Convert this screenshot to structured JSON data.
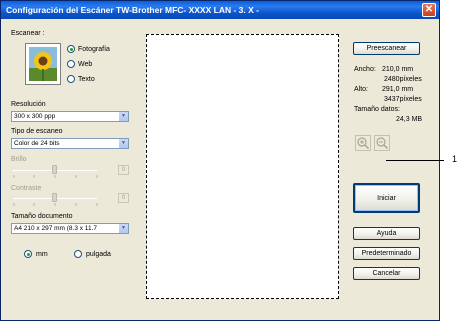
{
  "window": {
    "title": "Configuración del Escáner TW-Brother MFC- XXXX   LAN - 3. X -",
    "close_label": "✕"
  },
  "scan": {
    "label": "Escanear :",
    "options": [
      "Fotografía",
      "Web",
      "Texto"
    ],
    "selected": "Fotografía"
  },
  "resolution": {
    "label": "Resolución",
    "value": "300 x 300 ppp"
  },
  "scan_type": {
    "label": "Tipo de escaneo",
    "value": "Color de 24 bits"
  },
  "brightness": {
    "label": "Brillo",
    "value": "0"
  },
  "contrast": {
    "label": "Contraste",
    "value": "0"
  },
  "document_size": {
    "label": "Tamaño documento",
    "value": "A4 210 x 297 mm (8.3 x 11.7"
  },
  "units": {
    "options": [
      "mm",
      "pulgada"
    ],
    "selected": "mm"
  },
  "info": {
    "width_label": "Ancho:",
    "width_mm": "210,0 mm",
    "width_px": "2480píxeles",
    "height_label": "Alto:",
    "height_mm": "291,0 mm",
    "height_px": "3437píxeles",
    "data_size_label": "Tamaño datos:",
    "data_size": "24,3 MB"
  },
  "buttons": {
    "prescan": "Preescanear",
    "start": "Iniciar",
    "help": "Ayuda",
    "default": "Predeterminado",
    "cancel": "Cancelar"
  },
  "callout": "1"
}
